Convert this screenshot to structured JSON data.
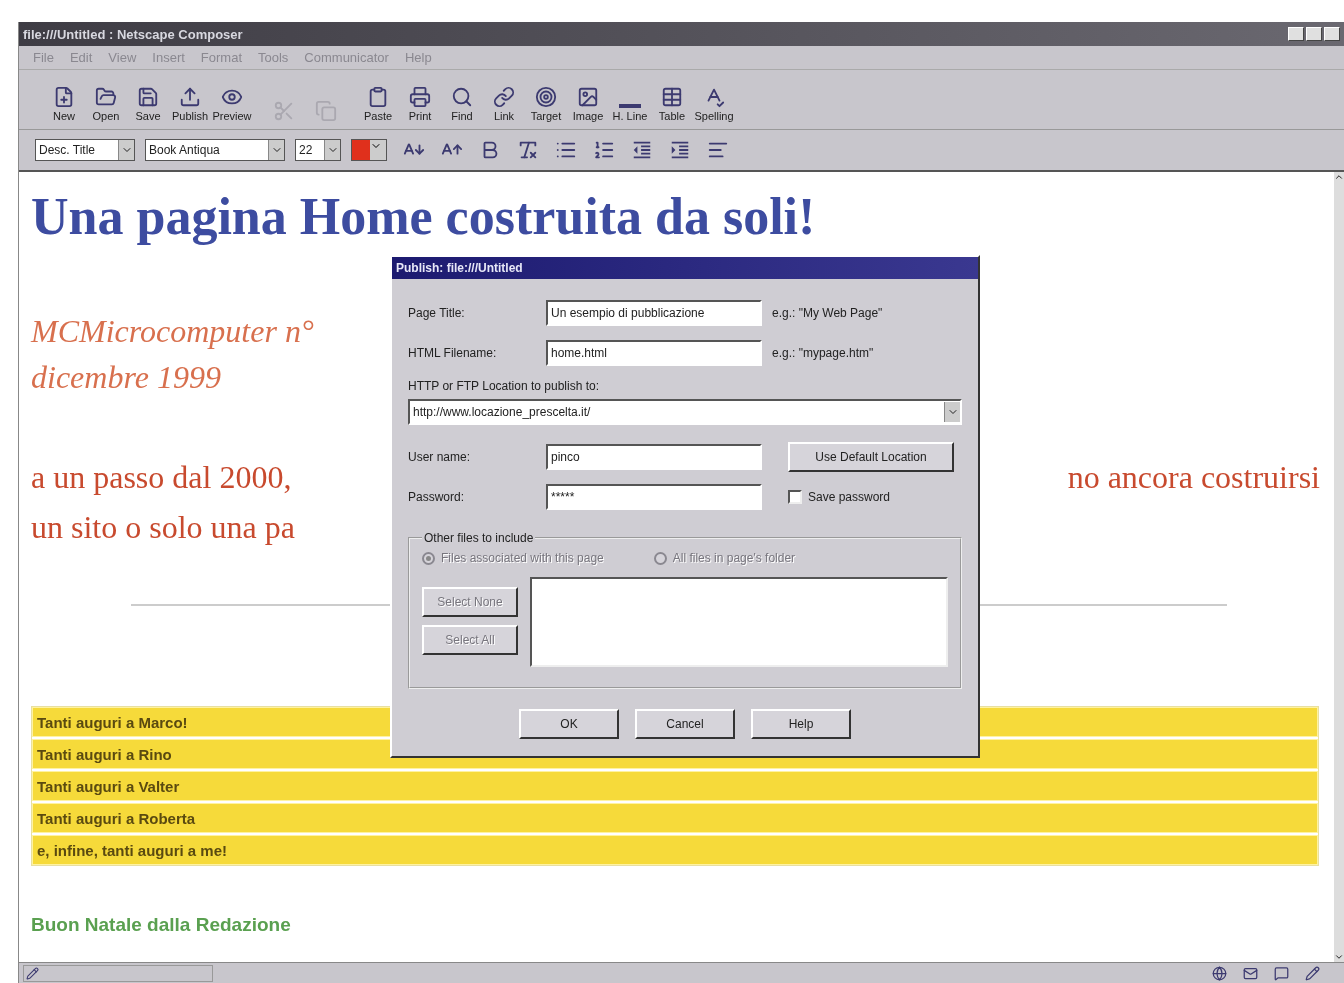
{
  "window": {
    "title": "file:///Untitled : Netscape Composer"
  },
  "menu": [
    "File",
    "Edit",
    "View",
    "Insert",
    "Format",
    "Tools",
    "Communicator",
    "Help"
  ],
  "toolbar": [
    {
      "kind": "new",
      "label": "New",
      "disabled": false
    },
    {
      "kind": "open",
      "label": "Open",
      "disabled": false
    },
    {
      "kind": "save",
      "label": "Save",
      "disabled": false
    },
    {
      "kind": "publish",
      "label": "Publish",
      "disabled": false
    },
    {
      "kind": "preview",
      "label": "Preview",
      "disabled": false
    },
    {
      "kind": "cut",
      "disabled": true
    },
    {
      "kind": "copy",
      "disabled": true
    },
    {
      "kind": "paste",
      "label": "Paste",
      "disabled": false
    },
    {
      "kind": "print",
      "label": "Print",
      "disabled": false
    },
    {
      "kind": "find",
      "label": "Find",
      "disabled": false
    },
    {
      "kind": "link",
      "label": "Link",
      "disabled": false
    },
    {
      "kind": "target",
      "label": "Target",
      "disabled": false
    },
    {
      "kind": "image",
      "label": "Image",
      "disabled": false
    },
    {
      "kind": "hline",
      "label": "H. Line",
      "disabled": false
    },
    {
      "kind": "table",
      "label": "Table",
      "disabled": false
    },
    {
      "kind": "spelling",
      "label": "Spelling",
      "disabled": false
    }
  ],
  "format_bar": {
    "paragraph_style": "Desc. Title",
    "font": "Book Antiqua",
    "size": "22",
    "color": "#e0301c",
    "buttons": [
      {
        "kind": "smaller"
      },
      {
        "kind": "larger"
      },
      {
        "kind": "bold"
      },
      {
        "kind": "clear"
      },
      {
        "kind": "bullets"
      },
      {
        "kind": "numbers"
      },
      {
        "kind": "outdent"
      },
      {
        "kind": "indent"
      },
      {
        "kind": "align"
      }
    ]
  },
  "document": {
    "heading": "Una pagina Home costruita da soli!",
    "issue_lines": [
      "MCMicrocomputer n°",
      "dicembre 1999"
    ],
    "paragraph_lines": [
      {
        "left": "a un passo dal 2000,",
        "right": "no ancora costruirsi"
      },
      {
        "left": "un sito o solo una pa"
      }
    ],
    "table_rows": [
      "Tanti auguri a Marco!",
      "Tanti auguri a Rino",
      "Tanti auguri a Valter",
      "Tanti auguri a Roberta",
      "e, infine, tanti auguri a me!"
    ],
    "footer": "Buon Natale dalla Redazione"
  },
  "dialog": {
    "title": "Publish: file:///Untitled",
    "fields": [
      {
        "label": "Page Title:",
        "value": "Un esempio di pubblicazione",
        "hint": "e.g.: \"My Web Page\""
      },
      {
        "label": "HTML Filename:",
        "value": "home.html",
        "hint": "e.g.: \"mypage.htm\""
      }
    ],
    "location_label": "HTTP or FTP Location to publish to:",
    "location": "http://www.locazione_prescelta.it/",
    "user_label": "User name:",
    "user": "pinco",
    "default_button": "Use Default Location",
    "password_label": "Password:",
    "password": "*****",
    "save_password": {
      "label": "Save password",
      "checked": false
    },
    "group_title": "Other files to include",
    "radios": [
      {
        "label": "Files associated with this page",
        "selected": true,
        "disabled": true
      },
      {
        "label": "All files in page's folder",
        "selected": false,
        "disabled": true
      }
    ],
    "side_buttons": [
      {
        "label": "Select None",
        "disabled": true
      },
      {
        "label": "Select All",
        "disabled": true
      }
    ],
    "buttons": [
      "OK",
      "Cancel",
      "Help"
    ]
  }
}
